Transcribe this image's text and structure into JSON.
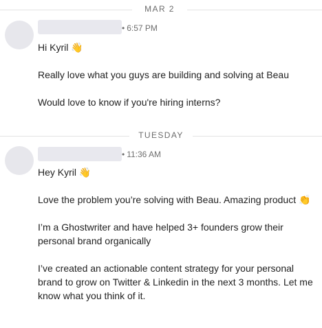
{
  "dividers": [
    {
      "label": "MAR 2"
    },
    {
      "label": "TUESDAY"
    }
  ],
  "messages": [
    {
      "time": "6:57 PM",
      "separator": "•",
      "paragraphs": [
        "Hi Kyril 👋",
        "Really love what you guys are building and solving at Beau",
        "Would love to know if you're hiring interns?"
      ]
    },
    {
      "time": "11:36 AM",
      "separator": "•",
      "paragraphs": [
        "Hey Kyril 👋",
        "Love the problem you’re solving with Beau. Amazing product 👏",
        "I’m a Ghostwriter and have helped 3+ founders grow their personal brand organically",
        "I’ve created an actionable content strategy for your personal brand to grow on Twitter & Linkedin in the next 3 months. Let me know what you think of it."
      ]
    }
  ]
}
